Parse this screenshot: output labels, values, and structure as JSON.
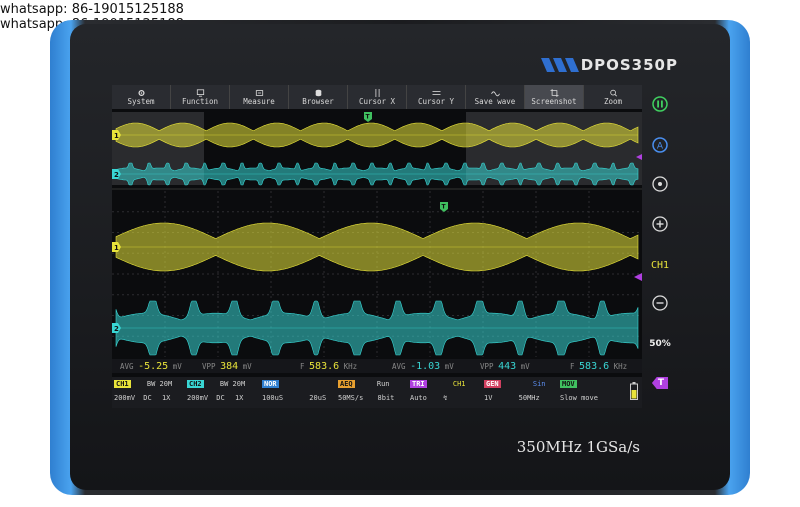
{
  "watermark": [
    "whatsapp: 86-19015125188",
    "whatsapp: 86-19015125188"
  ],
  "brand": "DPOS350P",
  "specs": "350MHz  1GSa/s",
  "colors": {
    "ch1": "#e8e33a",
    "ch2": "#39d6d4",
    "accent": "#b040e0"
  },
  "menu": [
    {
      "label": "System",
      "icon": "gear-icon"
    },
    {
      "label": "Function",
      "icon": "function-icon"
    },
    {
      "label": "Measure",
      "icon": "measure-icon"
    },
    {
      "label": "Browser",
      "icon": "database-icon"
    },
    {
      "label": "Cursor X",
      "icon": "cursor-x-icon"
    },
    {
      "label": "Cursor Y",
      "icon": "cursor-y-icon"
    },
    {
      "label": "Save wave",
      "icon": "wave-icon"
    },
    {
      "label": "Screenshot",
      "icon": "crop-icon"
    },
    {
      "label": "Zoom",
      "icon": "zoom-icon"
    }
  ],
  "markers": {
    "ch1": "1",
    "ch2": "2",
    "trigger": "T"
  },
  "measurements": [
    {
      "label": "AVG",
      "value": "-5.25",
      "unit": "mV",
      "ch": "ch1"
    },
    {
      "label": "VPP",
      "value": "384",
      "unit": "mV",
      "ch": "ch1"
    },
    {
      "label": "F",
      "value": "583.6",
      "unit": "KHz",
      "ch": "ch1"
    },
    {
      "label": "AVG",
      "value": "-1.03",
      "unit": "mV",
      "ch": "ch2"
    },
    {
      "label": "VPP",
      "value": "443",
      "unit": "mV",
      "ch": "ch2"
    },
    {
      "label": "F",
      "value": "583.6",
      "unit": "KHz",
      "ch": "ch2"
    }
  ],
  "status": {
    "ch1": {
      "tag": "CH1",
      "bw": "BW 20M",
      "scale": "200mV",
      "coupling": "DC",
      "probe": "1X"
    },
    "ch2": {
      "tag": "CH2",
      "bw": "BW 20M",
      "scale": "200mV",
      "coupling": "DC",
      "probe": "1X"
    },
    "timebase": {
      "tag": "NOR",
      "main": "100uS",
      "zoom": "20uS"
    },
    "acq": {
      "tag": "AEQ",
      "mode": "Run",
      "rate": "50MS/s",
      "bits": "8bit"
    },
    "trig": {
      "tag": "TRI",
      "source": "CH1",
      "mode": "Auto",
      "edge": "↯"
    },
    "gen": {
      "tag": "GEN",
      "wave": "Sin",
      "amp": "1V",
      "freq": "50MHz"
    },
    "mov": {
      "tag": "MOV",
      "mode": "Slow move"
    }
  },
  "side": {
    "ch_label": "CH1",
    "pct": "50%",
    "trig": "T"
  }
}
